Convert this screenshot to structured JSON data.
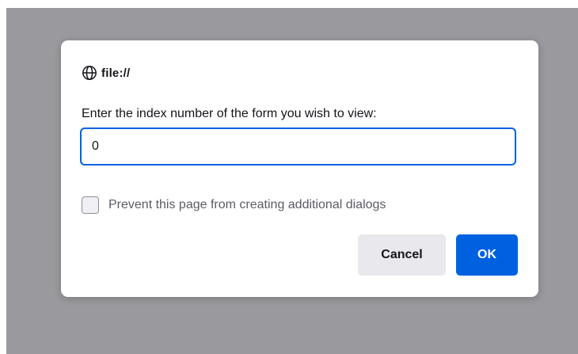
{
  "dialog": {
    "origin_icon": "globe-icon",
    "origin_text": "file://",
    "message": "Enter the index number of the form you wish to view:",
    "input_value": "0",
    "checkbox_label": "Prevent this page from creating additional dialogs",
    "checkbox_checked": false,
    "cancel_label": "Cancel",
    "ok_label": "OK"
  },
  "colors": {
    "backdrop": "#9a9a9e",
    "accent": "#0061e0",
    "cancel_bg": "#e8e8ed",
    "text": "#15141a"
  }
}
